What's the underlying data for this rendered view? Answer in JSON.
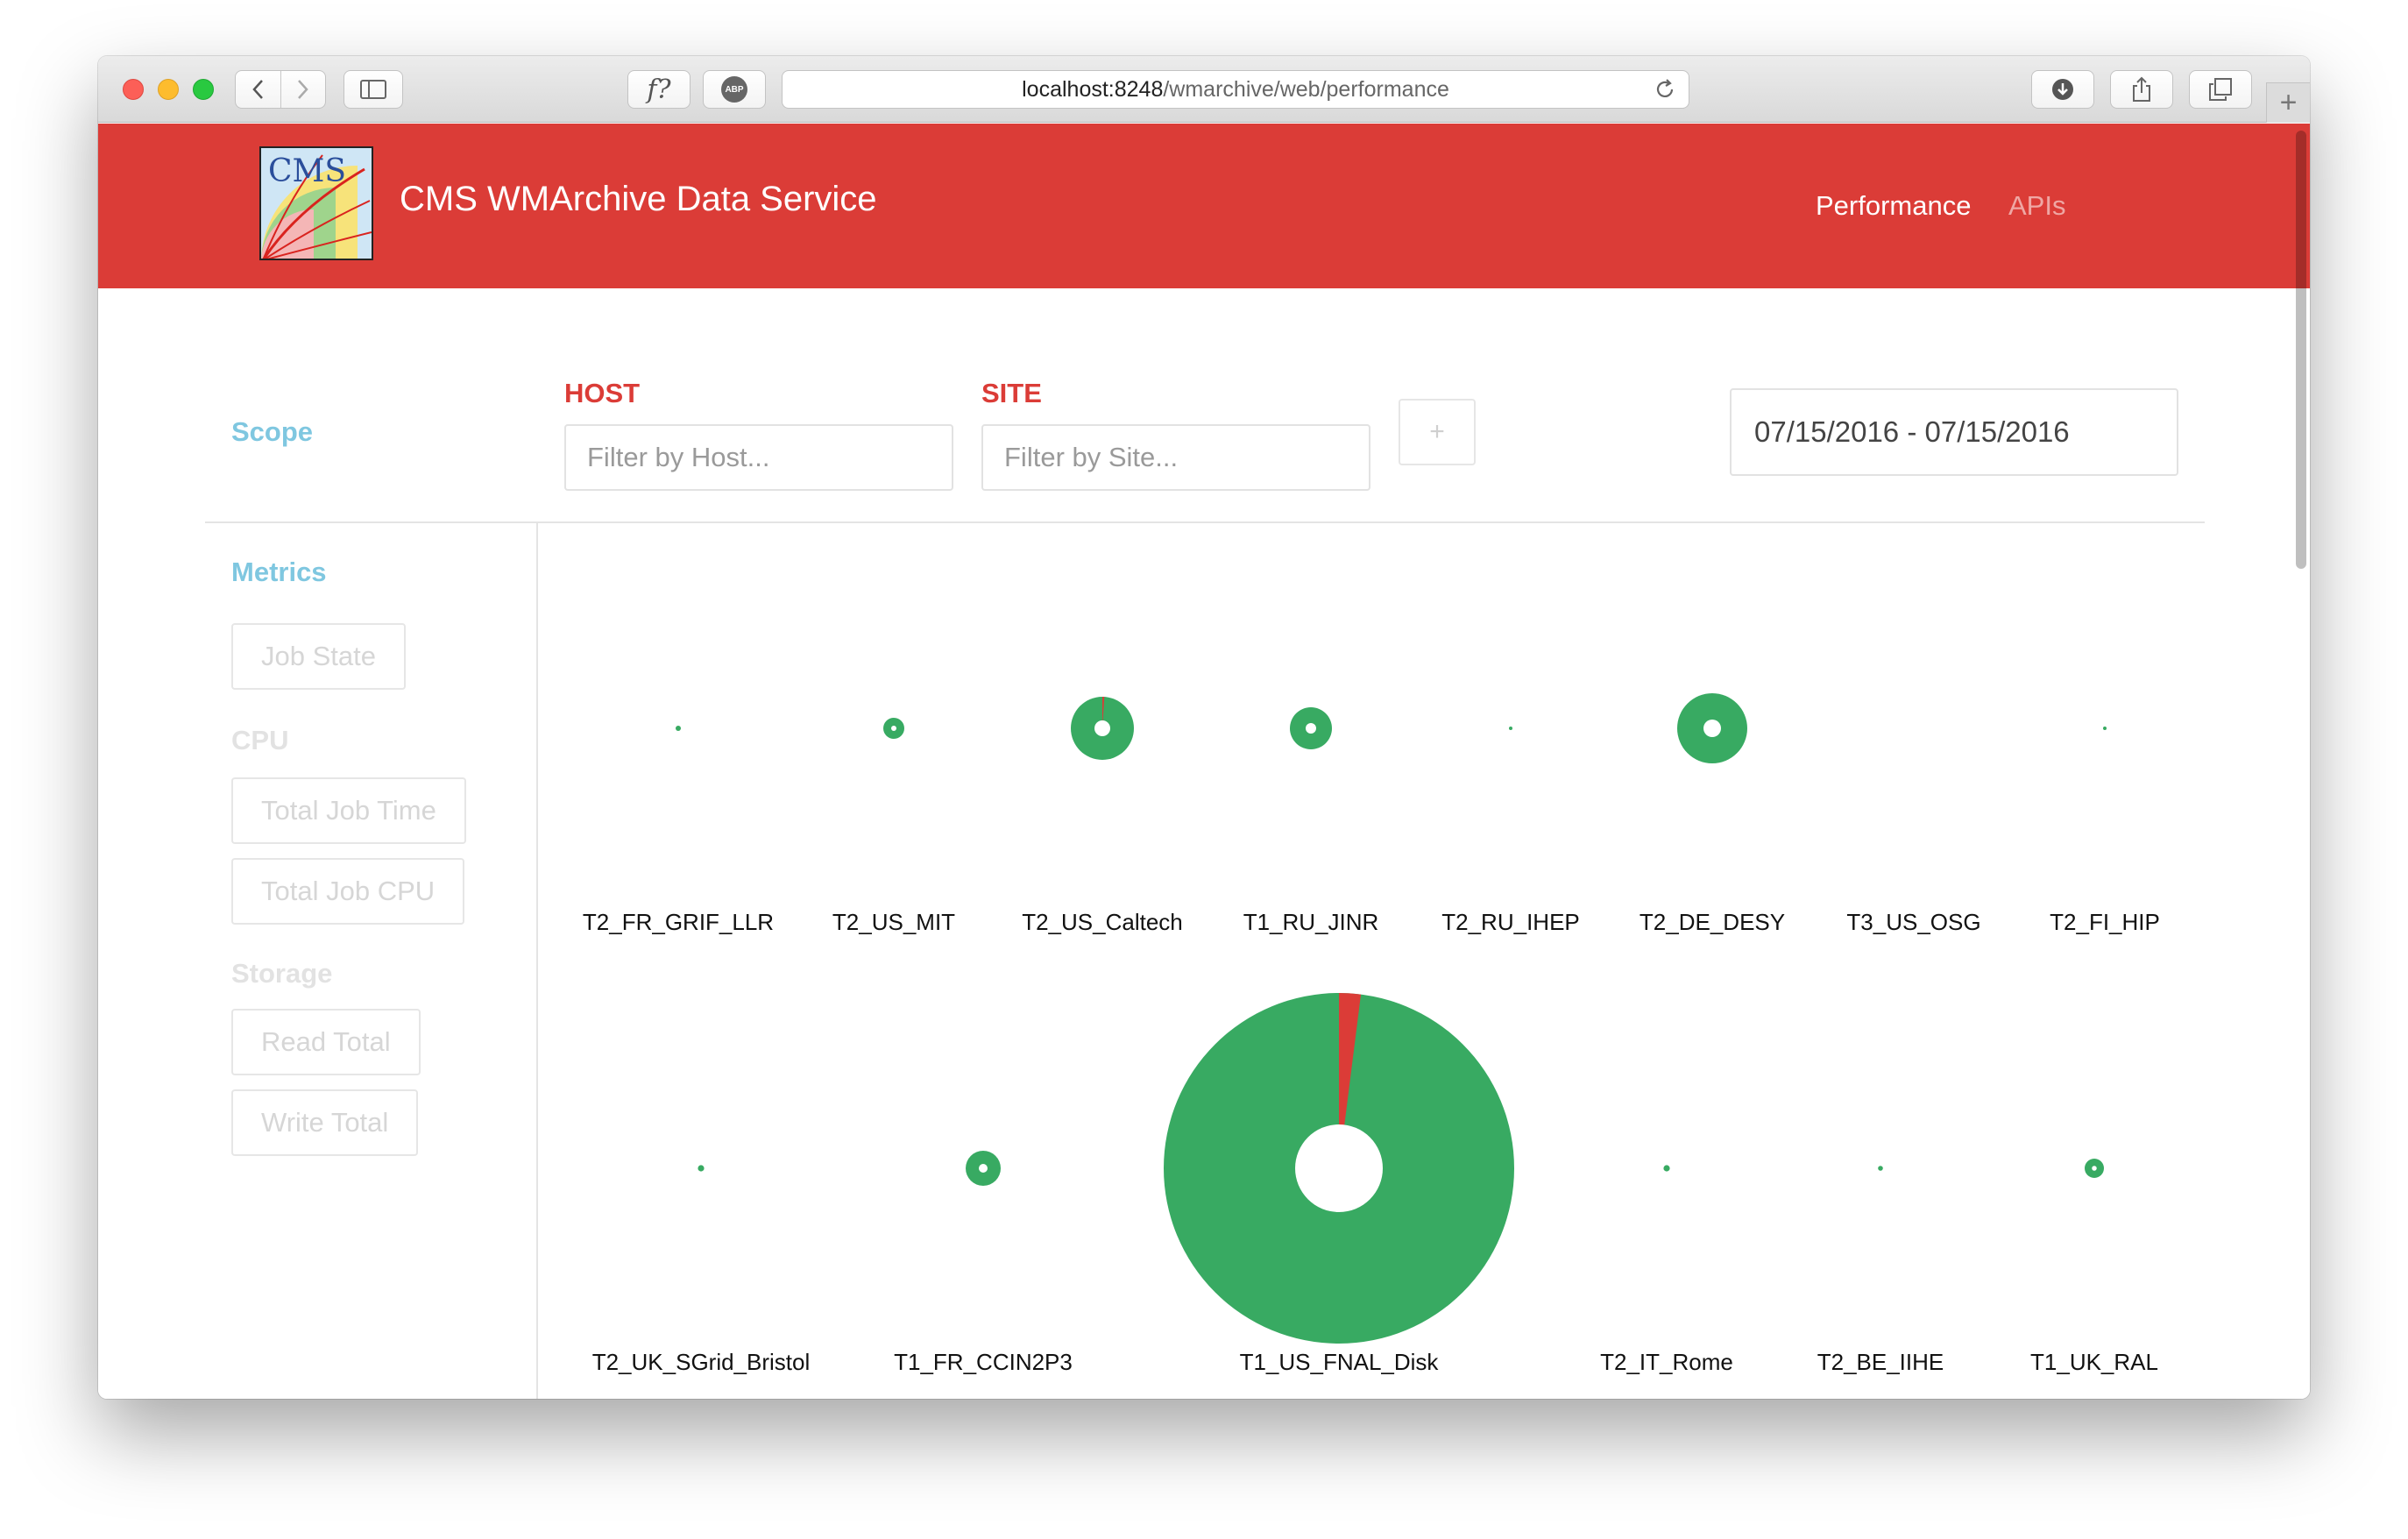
{
  "browser": {
    "url_host": "localhost:8248",
    "url_path": "/wmarchive/web/performance",
    "f_button": "f?",
    "abp_label": "ABP",
    "new_tab": "+"
  },
  "header": {
    "logo_text": "CMS",
    "title": "CMS WMArchive Data Service",
    "nav": {
      "performance": "Performance",
      "apis": "APIs"
    }
  },
  "scope": {
    "label": "Scope",
    "host_label": "HOST",
    "host_placeholder": "Filter by Host...",
    "site_label": "SITE",
    "site_placeholder": "Filter by Site...",
    "add_button": "+",
    "date_range": "07/15/2016 - 07/15/2016"
  },
  "metrics": {
    "label": "Metrics",
    "job_state": "Job State",
    "cpu_label": "CPU",
    "total_job_time": "Total Job Time",
    "total_job_cpu": "Total Job CPU",
    "storage_label": "Storage",
    "read_total": "Read Total",
    "write_total": "Write Total"
  },
  "colors": {
    "success": "#38aa62",
    "failure": "#db3c37",
    "accent": "#db3c37",
    "header_bg": "#db3c37",
    "section": "#7fc7e0"
  },
  "chart_data": {
    "type": "pie",
    "description_rows": 2,
    "sites": [
      {
        "name": "T2_FR_GRIF_LLR",
        "size": 0.015,
        "failure_fraction": 0
      },
      {
        "name": "T2_US_MIT",
        "size": 0.06,
        "failure_fraction": 0
      },
      {
        "name": "T2_US_Caltech",
        "size": 0.18,
        "failure_fraction": 0.01
      },
      {
        "name": "T1_RU_JINR",
        "size": 0.12,
        "failure_fraction": 0
      },
      {
        "name": "T2_RU_IHEP",
        "size": 0.008,
        "failure_fraction": 0
      },
      {
        "name": "T2_DE_DESY",
        "size": 0.2,
        "failure_fraction": 0
      },
      {
        "name": "T3_US_OSG",
        "size": 0.0,
        "failure_fraction": 0
      },
      {
        "name": "T2_FI_HIP",
        "size": 0.006,
        "failure_fraction": 0
      },
      {
        "name": "T2_UK_SGrid_Bristol",
        "size": 0.018,
        "failure_fraction": 0
      },
      {
        "name": "T1_FR_CCIN2P3",
        "size": 0.1,
        "failure_fraction": 0
      },
      {
        "name": "T1_US_FNAL_Disk",
        "size": 1.0,
        "failure_fraction": 0.02
      },
      {
        "name": "T2_IT_Rome",
        "size": 0.018,
        "failure_fraction": 0
      },
      {
        "name": "T2_BE_IIHE",
        "size": 0.014,
        "failure_fraction": 0
      },
      {
        "name": "T1_UK_RAL",
        "size": 0.055,
        "failure_fraction": 0
      }
    ]
  }
}
